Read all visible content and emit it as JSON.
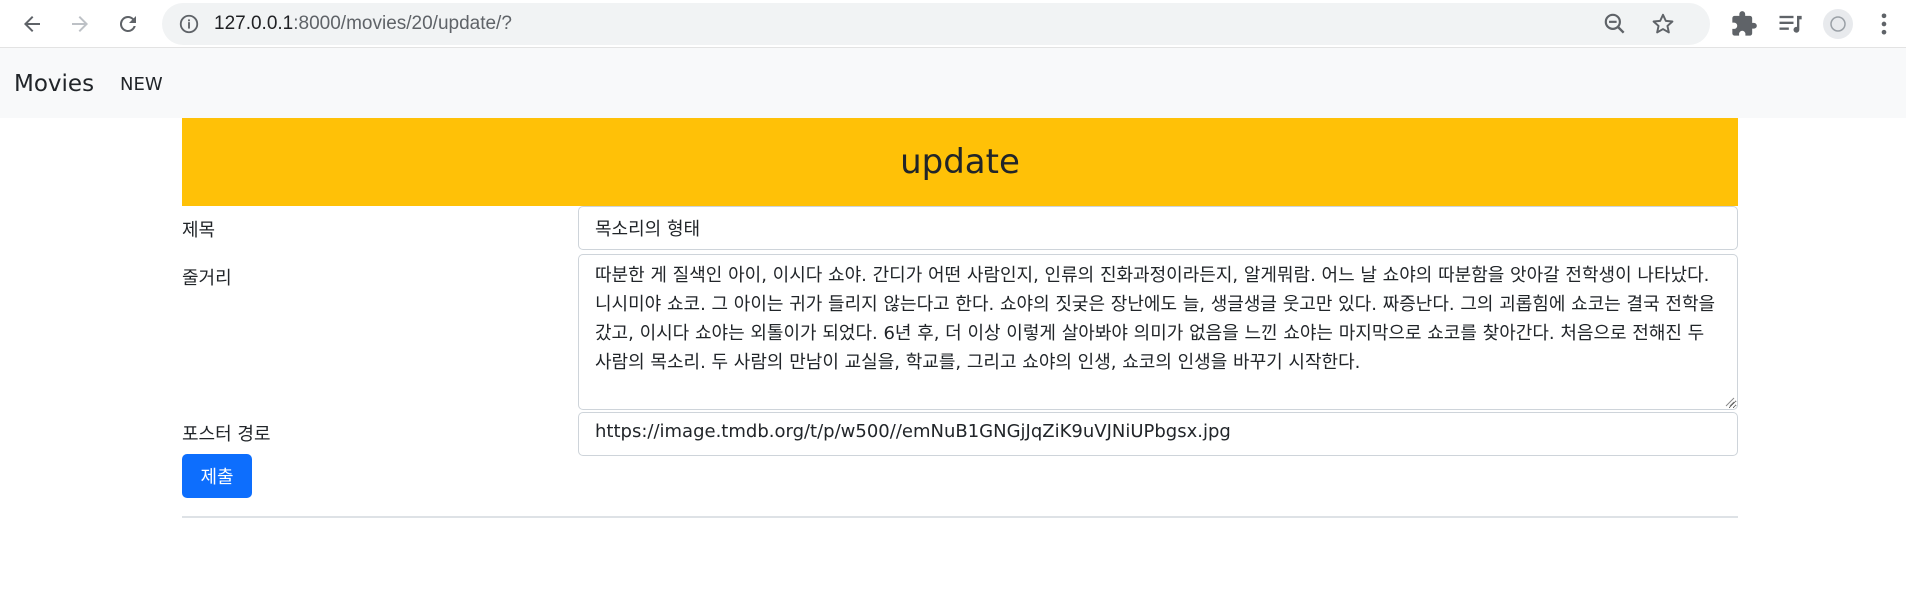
{
  "browser": {
    "url_host": "127.0.0.1",
    "url_path": ":8000/movies/20/update/?",
    "icons": [
      "back-arrow-icon",
      "forward-arrow-icon",
      "reload-icon",
      "site-info-icon",
      "zoom-icon",
      "bookmark-star-icon",
      "extensions-icon",
      "reading-list-icon",
      "profile-icon",
      "more-menu-icon"
    ]
  },
  "navbar": {
    "brand": "Movies",
    "links": [
      "NEW"
    ]
  },
  "page": {
    "heading": "update"
  },
  "form": {
    "title_label": "제목",
    "title_value": "목소리의 형태",
    "plot_label": "줄거리",
    "plot_value": "따분한 게 질색인 아이, 이시다 쇼야.  간디가 어떤 사람인지, 인류의 진화과정이라든지, 알게뭐람.  어느 날 쇼야의 따분함을 앗아갈 전학생이 나타났다. 니시미야 쇼코. 그 아이는 귀가 들리지 않는다고 한다.  쇼야의 짓궂은 장난에도 늘, 생글생글 웃고만 있다. 짜증난다.  그의 괴롭힘에 쇼코는 결국 전학을 갔고, 이시다 쇼야는 외톨이가 되었다.  6년 후, 더 이상 이렇게 살아봐야 의미가 없음을 느낀 쇼야는 마지막으로 쇼코를 찾아간다.  처음으로 전해진 두 사람의 목소리. 두 사람의 만남이 교실을, 학교를,  그리고 쇼야의 인생, 쇼코의 인생을 바꾸기 시작한다.",
    "poster_label": "포스터 경로",
    "poster_value": "https://image.tmdb.org/t/p/w500//emNuB1GNGjJqZiK9uVJNiUPbgsx.jpg",
    "submit_label": "제출"
  },
  "colors": {
    "header_bg": "#ffc107",
    "submit_bg": "#0d6efd",
    "navbar_bg": "#f8f9fa"
  }
}
